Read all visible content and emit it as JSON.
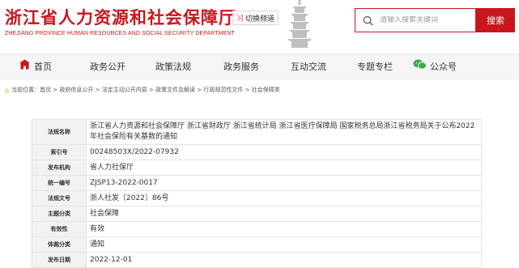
{
  "header": {
    "title": "浙江省人力资源和社会保障厅",
    "subtitle": "ZHEJIANG PROVINCE HUMAN RESOURCES AND SOCIAL SECURITY DEPARTMENT",
    "switch_channel": "切换频道",
    "search": {
      "placeholder": "请输入搜索关键词",
      "button": "搜索"
    },
    "colors": {
      "brand": "#c8161d"
    }
  },
  "nav": {
    "items": [
      {
        "label": "首页",
        "icon": "home-icon"
      },
      {
        "label": "政务公开"
      },
      {
        "label": "政策法规"
      },
      {
        "label": "政务服务"
      },
      {
        "label": "互动交流"
      },
      {
        "label": "专题专栏"
      },
      {
        "label": "公众号",
        "icon": "wechat-icon"
      }
    ]
  },
  "breadcrumb": "当前位置：首页 > 政府信息公开 > 法定主动公开内容 > 政策文件及解读 > 行政规范性文件 > 社会保障类",
  "info": {
    "rows": [
      {
        "label": "法规名称",
        "value": "浙江省人力资源和社会保障厅 浙江省财政厅 浙江省统计局 浙江省医疗保障局 国家税务总局浙江省税务局关于公布2022年社会保险有关基数的通知"
      },
      {
        "label": "索引号",
        "value": "00248503X/2022-07932"
      },
      {
        "label": "发布机构",
        "value": "省人力社保厅"
      },
      {
        "label": "统一编号",
        "value": "ZJSP13-2022-0017"
      },
      {
        "label": "法规文号",
        "value": "浙人社发〔2022〕86号"
      },
      {
        "label": "主题分类",
        "value": "社会保障"
      },
      {
        "label": "有效性",
        "value": "有效"
      },
      {
        "label": "体裁分类",
        "value": "通知"
      },
      {
        "label": "发布日期",
        "value": "2022-12-01"
      }
    ]
  }
}
